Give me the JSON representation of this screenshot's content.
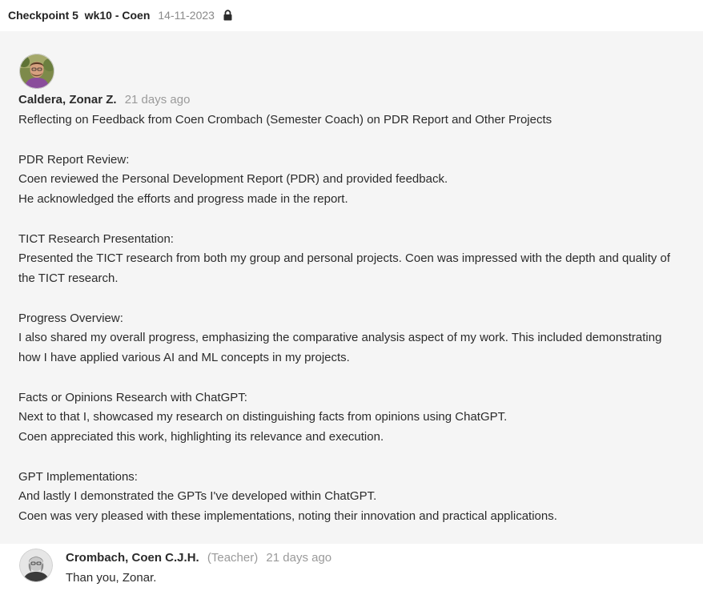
{
  "header": {
    "title": "Checkpoint 5  wk10 - Coen",
    "date": "14-11-2023",
    "lock_icon": "lock-icon"
  },
  "post": {
    "author": "Caldera, Zonar Z.",
    "time": "21 days ago",
    "avatar_icon": "user-avatar",
    "lines": [
      "Reflecting on Feedback from Coen Crombach (Semester Coach) on PDR Report and Other Projects",
      "",
      "PDR Report Review:",
      "Coen reviewed the Personal Development Report (PDR) and provided feedback.",
      "He acknowledged the efforts and progress made in the report.",
      "",
      "TICT Research Presentation:",
      "Presented the TICT research from both my group and personal projects. Coen was impressed with the depth and quality of",
      "the TICT research.",
      "",
      "Progress Overview:",
      "I also shared my overall progress, emphasizing the comparative analysis aspect of my work. This included demonstrating",
      "how I have applied various AI and ML concepts in my projects.",
      "",
      "Facts or Opinions Research with ChatGPT:",
      "Next to that I, showcased my research on distinguishing facts from opinions using ChatGPT.",
      "Coen appreciated this work, highlighting its relevance and execution.",
      "",
      "GPT Implementations:",
      "And lastly I demonstrated the GPTs I've developed within ChatGPT.",
      "Coen was very pleased with these implementations, noting their innovation and practical applications."
    ]
  },
  "comment": {
    "author": "Crombach, Coen C.J.H.",
    "role": "(Teacher)",
    "time": "21 days ago",
    "text": "Than you, Zonar.",
    "avatar_icon": "user-avatar"
  }
}
